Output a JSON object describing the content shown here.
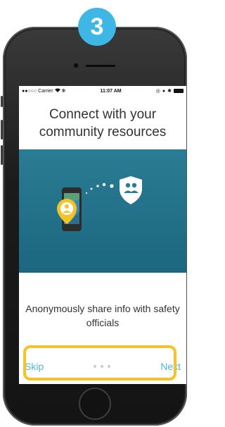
{
  "step_badge": "3",
  "status_bar": {
    "carrier": "Carrier",
    "time": "11:07 AM"
  },
  "onboarding": {
    "title": "Connect with your community resources",
    "subtitle": "Anonymously share info with safety officials",
    "skip_label": "Skip",
    "next_label": "Next",
    "page_count": 3,
    "current_page": 3
  },
  "colors": {
    "accent": "#4cb8e3",
    "badge": "#3fb7e4",
    "highlight": "#f3c327",
    "hero_bg": "#1c6680"
  }
}
